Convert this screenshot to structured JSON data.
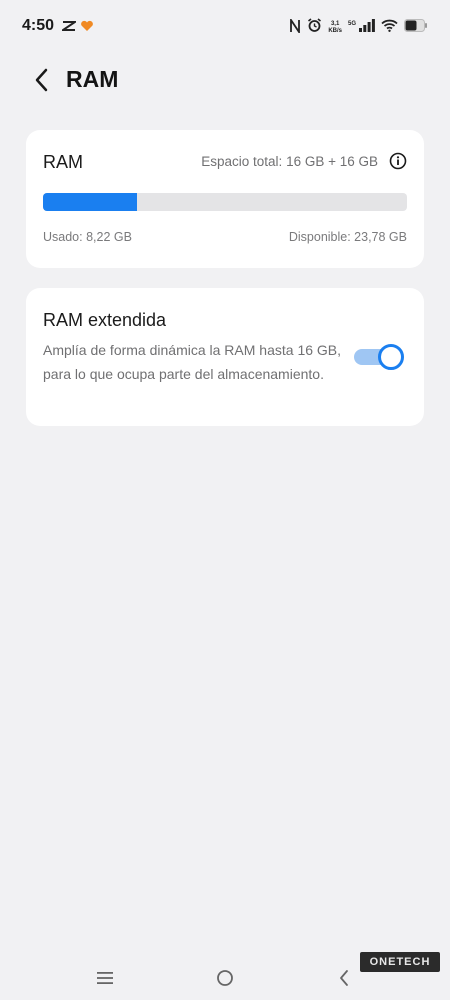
{
  "status_bar": {
    "time": "4:50",
    "speed_value": "3,1",
    "speed_unit": "KB/s",
    "network_label": "5G",
    "icons": [
      "capcut-icon",
      "heart-icon",
      "nfc-icon",
      "alarm-icon",
      "signal-icon",
      "wifi-icon",
      "battery-icon"
    ]
  },
  "header": {
    "title": "RAM",
    "back_icon": "chevron-left-icon"
  },
  "ram_card": {
    "title": "RAM",
    "total_label": "Espacio total: 16 GB + 16 GB",
    "used_label": "Usado: 8,22 GB",
    "available_label": "Disponible: 23,78 GB",
    "usage_fraction": 0.257,
    "bar_color": "#1a7ff0",
    "info_icon": "info-icon"
  },
  "extended_ram_card": {
    "title": "RAM extendida",
    "description": "Amplía de forma dinámica la RAM hasta 16 GB, para lo que ocupa parte del almacenamiento.",
    "toggle_on": true,
    "accent_color": "#1a7ff0"
  },
  "nav_bar": {
    "icons": [
      "menu-icon",
      "home-icon",
      "back-icon"
    ]
  },
  "watermark": {
    "text": "ONETECH"
  }
}
